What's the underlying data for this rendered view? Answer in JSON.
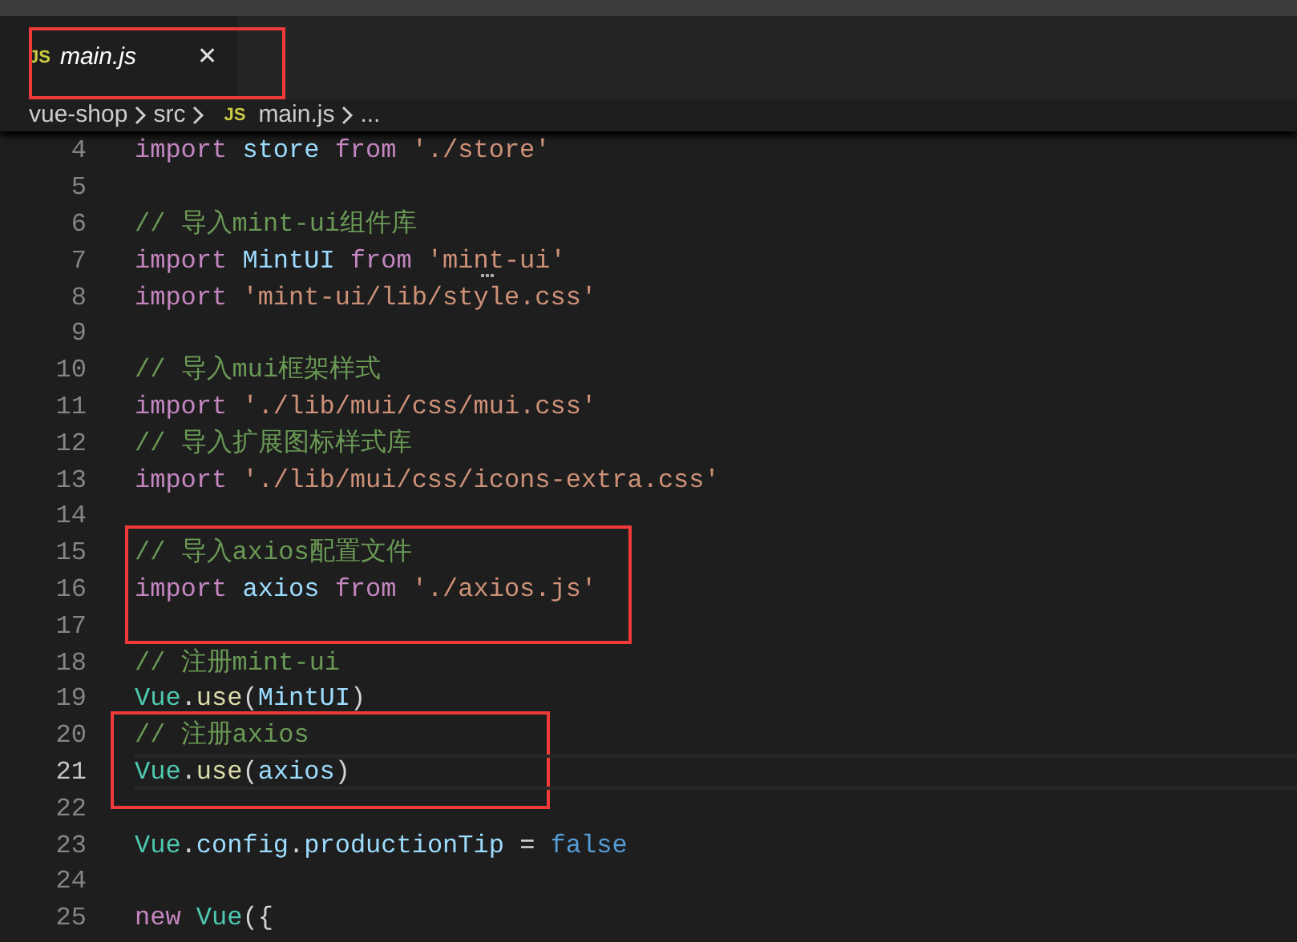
{
  "tabs": [
    {
      "label": "main.js",
      "icon": "JS",
      "close": "✕",
      "selected": true,
      "annotated": true
    }
  ],
  "breadcrumb": [
    {
      "label": "vue-shop"
    },
    {
      "label": "src"
    },
    {
      "label": "main.js",
      "icon": "JS"
    },
    {
      "label": "..."
    }
  ],
  "editor": {
    "lines": [
      {
        "number": "4",
        "tokens": [
          {
            "kind": "keyword",
            "text": "import"
          },
          {
            "kind": "variable",
            "text": " store "
          },
          {
            "kind": "keyword",
            "text": "from"
          },
          {
            "kind": "string",
            "text": " './store'"
          }
        ]
      },
      {
        "number": "5"
      },
      {
        "number": "6",
        "tokens": [
          {
            "kind": "comment",
            "text": "// 导入mint-ui组件库"
          }
        ]
      },
      {
        "number": "7",
        "tokens": [
          {
            "kind": "keyword",
            "text": "import"
          },
          {
            "kind": "variable",
            "text": " MintUI "
          },
          {
            "kind": "keyword",
            "text": "from"
          },
          {
            "kind": "string",
            "text": " 'mint-ui'",
            "hint": true
          }
        ]
      },
      {
        "number": "8",
        "tokens": [
          {
            "kind": "keyword",
            "text": "import"
          },
          {
            "kind": "string",
            "text": " 'mint-ui/lib/style.css'"
          }
        ]
      },
      {
        "number": "9"
      },
      {
        "number": "10",
        "tokens": [
          {
            "kind": "comment",
            "text": "// 导入mui框架样式"
          }
        ]
      },
      {
        "number": "11",
        "tokens": [
          {
            "kind": "keyword",
            "text": "import"
          },
          {
            "kind": "string",
            "text": " './lib/mui/css/mui.css'"
          }
        ]
      },
      {
        "number": "12",
        "tokens": [
          {
            "kind": "comment",
            "text": "// 导入扩展图标样式库"
          }
        ]
      },
      {
        "number": "13",
        "tokens": [
          {
            "kind": "keyword",
            "text": "import"
          },
          {
            "kind": "string",
            "text": " './lib/mui/css/icons-extra.css'"
          }
        ]
      },
      {
        "number": "14"
      },
      {
        "number": "15",
        "annotated": true,
        "tokens": [
          {
            "kind": "comment",
            "text": "// 导入axios配置文件"
          }
        ]
      },
      {
        "number": "16",
        "annotated": true,
        "tokens": [
          {
            "kind": "keyword",
            "text": "import"
          },
          {
            "kind": "variable",
            "text": " axios "
          },
          {
            "kind": "keyword",
            "text": "from"
          },
          {
            "kind": "string",
            "text": " './axios.js'"
          }
        ]
      },
      {
        "number": "17",
        "annotated": true
      },
      {
        "number": "18",
        "tokens": [
          {
            "kind": "comment",
            "text": "// 注册mint-ui"
          }
        ]
      },
      {
        "number": "19",
        "tokens": [
          {
            "kind": "class",
            "text": "Vue"
          },
          {
            "kind": "punct",
            "text": "."
          },
          {
            "kind": "function",
            "text": "use"
          },
          {
            "kind": "punct",
            "text": "("
          },
          {
            "kind": "variable",
            "text": "MintUI"
          },
          {
            "kind": "punct",
            "text": ")"
          }
        ]
      },
      {
        "number": "20",
        "annotated": true,
        "tokens": [
          {
            "kind": "comment",
            "text": "// 注册axios"
          }
        ]
      },
      {
        "number": "21",
        "annotated": true,
        "current": true,
        "tokens": [
          {
            "kind": "class",
            "text": "Vue"
          },
          {
            "kind": "punct",
            "text": "."
          },
          {
            "kind": "function",
            "text": "use"
          },
          {
            "kind": "punct",
            "text": "("
          },
          {
            "kind": "variable",
            "text": "axios"
          },
          {
            "kind": "punct",
            "text": ")"
          }
        ]
      },
      {
        "number": "22"
      },
      {
        "number": "23",
        "tokens": [
          {
            "kind": "class",
            "text": "Vue"
          },
          {
            "kind": "punct",
            "text": "."
          },
          {
            "kind": "variable",
            "text": "config"
          },
          {
            "kind": "punct",
            "text": "."
          },
          {
            "kind": "variable",
            "text": "productionTip"
          },
          {
            "kind": "punct",
            "text": " = "
          },
          {
            "kind": "boolean",
            "text": "false"
          }
        ]
      },
      {
        "number": "24"
      },
      {
        "number": "25",
        "tokens": [
          {
            "kind": "keyword",
            "text": "new "
          },
          {
            "kind": "class",
            "text": "Vue"
          },
          {
            "kind": "punct",
            "text": "({"
          }
        ]
      }
    ]
  }
}
